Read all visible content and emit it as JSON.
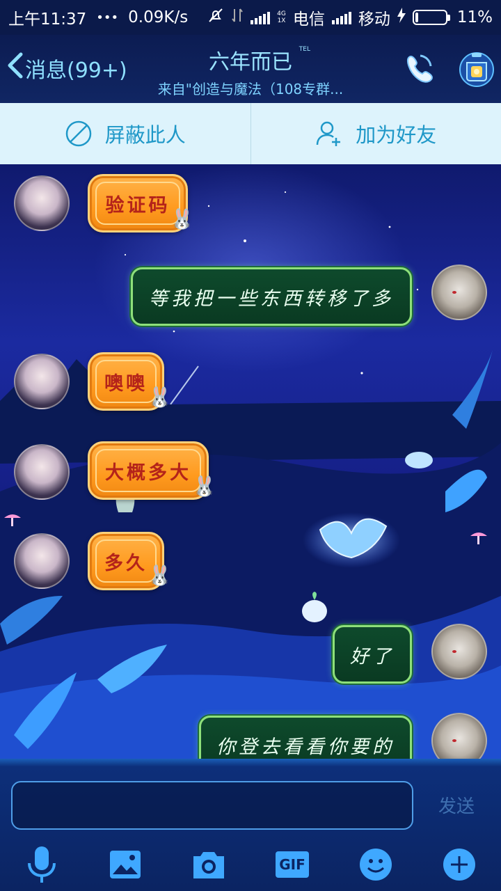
{
  "status_bar": {
    "time": "上午11:37",
    "dots": "•••",
    "net_speed": "0.09K/s",
    "net_type_top": "4G",
    "net_type_bottom": "1X",
    "carrier1": "电信",
    "carrier2": "移动",
    "battery_text": "11%",
    "battery_level": 0.11
  },
  "header": {
    "back_label": "消息(99+)",
    "title": "六年而已",
    "title_badge": "TEL",
    "subtitle": "来自\"创造与魔法（108专群..."
  },
  "action_bar": {
    "block_label": "屏蔽此人",
    "add_friend_label": "加为好友"
  },
  "messages": [
    {
      "side": "left",
      "text": "验证码"
    },
    {
      "side": "right",
      "text": "等我把一些东西转移了多"
    },
    {
      "side": "left",
      "text": "噢噢"
    },
    {
      "side": "left",
      "text": "大概多大"
    },
    {
      "side": "left",
      "text": "多久"
    },
    {
      "side": "right",
      "text": "好了"
    },
    {
      "side": "right",
      "text": "你登去看看你要的"
    }
  ],
  "input": {
    "value": "",
    "placeholder": "",
    "send_label": "发送"
  },
  "toolbar": {
    "icons": [
      "microphone-icon",
      "image-icon",
      "camera-icon",
      "gif-icon",
      "emoji-icon",
      "plus-icon"
    ],
    "gif_label": "GIF"
  },
  "colors": {
    "header_text": "#9be4ff",
    "action_bar_bg": "#ddf3fc",
    "action_text": "#1f98c8",
    "left_bubble": "#ff9a1e",
    "left_bubble_text": "#b4231a",
    "right_bubble": "#0a3a22",
    "right_bubble_border": "#8ee07a",
    "input_bar": "#0b2462",
    "send_text": "#3e6fb0"
  }
}
